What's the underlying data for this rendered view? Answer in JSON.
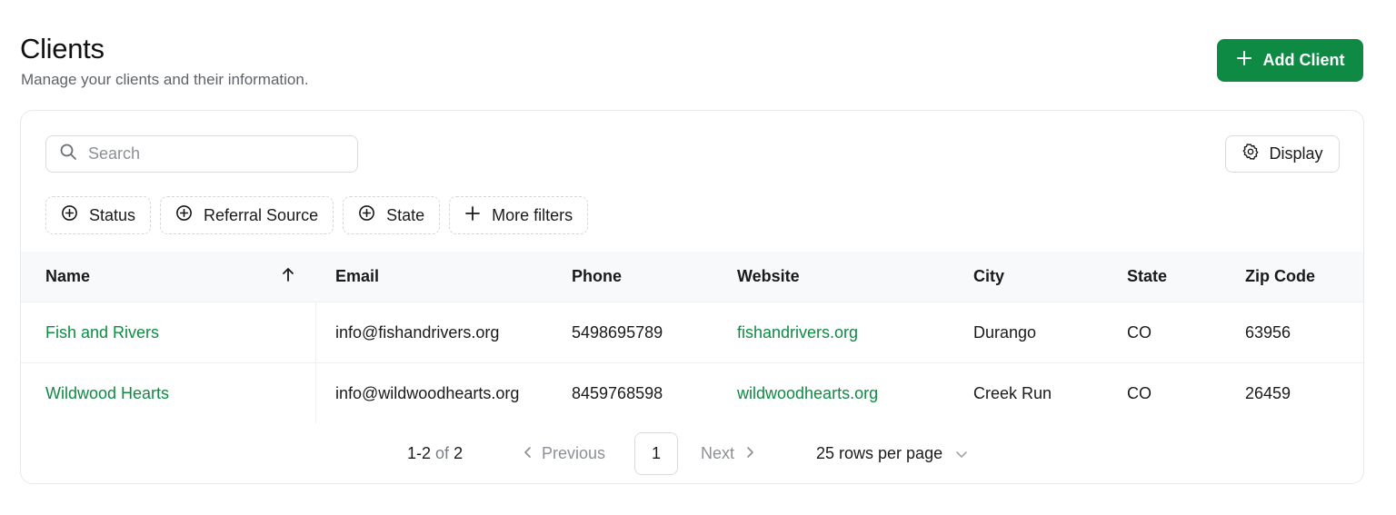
{
  "header": {
    "title": "Clients",
    "subtitle": "Manage your clients and their information.",
    "add_button_label": "Add Client"
  },
  "toolbar": {
    "search_placeholder": "Search",
    "display_label": "Display"
  },
  "filters": [
    {
      "label": "Status",
      "icon": "plus-circle-icon"
    },
    {
      "label": "Referral Source",
      "icon": "plus-circle-icon"
    },
    {
      "label": "State",
      "icon": "plus-circle-icon"
    },
    {
      "label": "More filters",
      "icon": "plus-icon"
    }
  ],
  "table": {
    "columns": [
      "Name",
      "Email",
      "Phone",
      "Website",
      "City",
      "State",
      "Zip Code"
    ],
    "sort": {
      "column": "Name",
      "direction": "ascending"
    },
    "rows": [
      {
        "name": "Fish and Rivers",
        "email": "info@fishandrivers.org",
        "phone": "5498695789",
        "website": "fishandrivers.org",
        "city": "Durango",
        "state": "CO",
        "zip": "63956"
      },
      {
        "name": "Wildwood Hearts",
        "email": "info@wildwoodhearts.org",
        "phone": "8459768598",
        "website": "wildwoodhearts.org",
        "city": "Creek Run",
        "state": "CO",
        "zip": "26459"
      }
    ]
  },
  "pagination": {
    "range": "1-2",
    "of_label": "of",
    "total": "2",
    "previous_label": "Previous",
    "current_page": "1",
    "next_label": "Next",
    "rows_per_page": "25 rows per page"
  },
  "colors": {
    "accent": "#0f8a45",
    "header_bg": "#f7f9fa",
    "muted_text": "#5f6368"
  }
}
